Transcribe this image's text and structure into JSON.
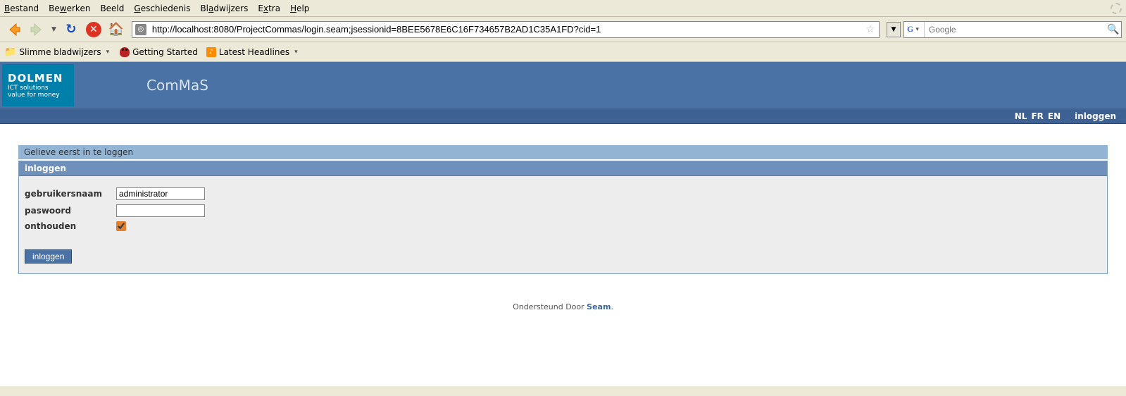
{
  "menubar": {
    "file": "Bestand",
    "edit": "Bewerken",
    "view": "Beeld",
    "history": "Geschiedenis",
    "bookmarks": "Bladwijzers",
    "extra": "Extra",
    "help": "Help"
  },
  "urlbar": {
    "value": "http://localhost:8080/ProjectCommas/login.seam;jsessionid=8BEE5678E6C16F734657B2AD1C35A1FD?cid=1"
  },
  "searchbar": {
    "engine": "G",
    "placeholder": "Google"
  },
  "bookmarks": {
    "smart": "Slimme bladwijzers",
    "getting_started": "Getting Started",
    "latest": "Latest Headlines"
  },
  "logo": {
    "brand": "DOLMEN",
    "line1": "ICT solutions",
    "line2": "value for money"
  },
  "app_title": "ComMaS",
  "nav": {
    "lang_nl": "NL",
    "lang_fr": "FR",
    "lang_en": "EN",
    "login": "inloggen"
  },
  "message": "Gelieve eerst in te loggen",
  "panel_title": "inloggen",
  "form": {
    "username_label": "gebruikersnaam",
    "username_value": "administrator",
    "password_label": "paswoord",
    "password_value": "",
    "remember_label": "onthouden",
    "remember_checked": true,
    "submit_label": "inloggen"
  },
  "footer": {
    "prefix": "Ondersteund Door ",
    "link": "Seam",
    "suffix": "."
  }
}
